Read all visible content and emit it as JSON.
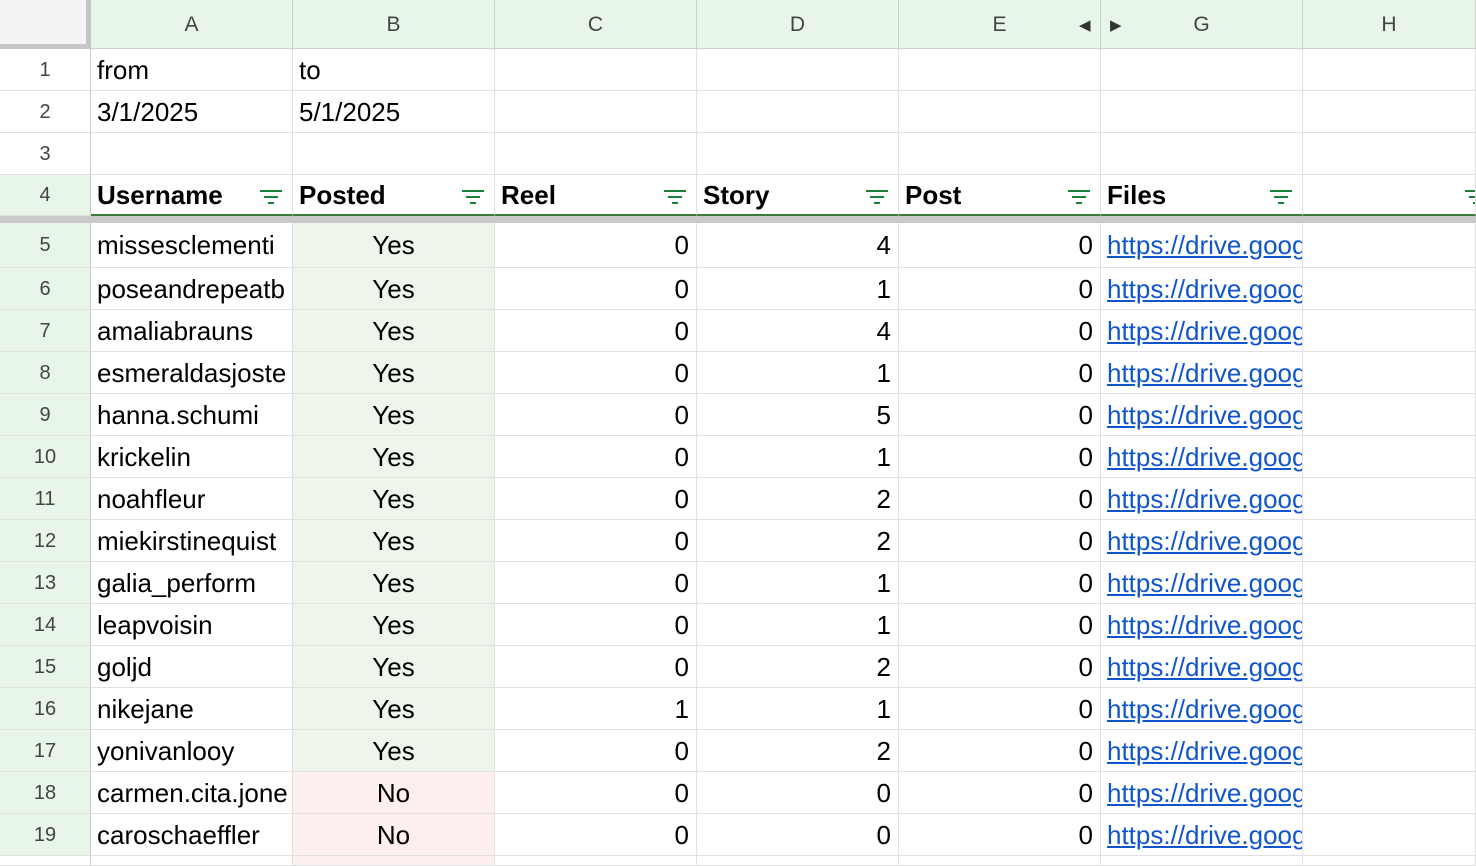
{
  "columns": [
    "A",
    "B",
    "C",
    "D",
    "E",
    "G",
    "H"
  ],
  "row1": {
    "num": "1",
    "a": "from",
    "b": "to"
  },
  "row2": {
    "num": "2",
    "a": "3/1/2025",
    "b": "5/1/2025"
  },
  "row3": {
    "num": "3"
  },
  "header_row": {
    "num": "4",
    "cells": [
      "Username",
      "Posted",
      "Reel",
      "Story",
      "Post",
      "Files",
      ""
    ]
  },
  "rows": [
    {
      "num": "5",
      "username": "missesclementi",
      "posted": "Yes",
      "reel": "0",
      "story": "4",
      "post": "0",
      "files": "https://drive.goog"
    },
    {
      "num": "6",
      "username": "poseandrepeatb",
      "posted": "Yes",
      "reel": "0",
      "story": "1",
      "post": "0",
      "files": "https://drive.goog"
    },
    {
      "num": "7",
      "username": "amaliabrauns",
      "posted": "Yes",
      "reel": "0",
      "story": "4",
      "post": "0",
      "files": "https://drive.goog"
    },
    {
      "num": "8",
      "username": "esmeraldasjoste",
      "posted": "Yes",
      "reel": "0",
      "story": "1",
      "post": "0",
      "files": "https://drive.goog"
    },
    {
      "num": "9",
      "username": "hanna.schumi",
      "posted": "Yes",
      "reel": "0",
      "story": "5",
      "post": "0",
      "files": "https://drive.goog"
    },
    {
      "num": "10",
      "username": "krickelin",
      "posted": "Yes",
      "reel": "0",
      "story": "1",
      "post": "0",
      "files": "https://drive.goog"
    },
    {
      "num": "11",
      "username": "noahfleur",
      "posted": "Yes",
      "reel": "0",
      "story": "2",
      "post": "0",
      "files": "https://drive.goog"
    },
    {
      "num": "12",
      "username": "miekirstinequist",
      "posted": "Yes",
      "reel": "0",
      "story": "2",
      "post": "0",
      "files": "https://drive.goog"
    },
    {
      "num": "13",
      "username": "galia_perform",
      "posted": "Yes",
      "reel": "0",
      "story": "1",
      "post": "0",
      "files": "https://drive.goog"
    },
    {
      "num": "14",
      "username": "leapvoisin",
      "posted": "Yes",
      "reel": "0",
      "story": "1",
      "post": "0",
      "files": "https://drive.goog"
    },
    {
      "num": "15",
      "username": "goljd",
      "posted": "Yes",
      "reel": "0",
      "story": "2",
      "post": "0",
      "files": "https://drive.goog"
    },
    {
      "num": "16",
      "username": "nikejane",
      "posted": "Yes",
      "reel": "1",
      "story": "1",
      "post": "0",
      "files": "https://drive.goog"
    },
    {
      "num": "17",
      "username": "yonivanlooy",
      "posted": "Yes",
      "reel": "0",
      "story": "2",
      "post": "0",
      "files": "https://drive.goog"
    },
    {
      "num": "18",
      "username": "carmen.cita.jone",
      "posted": "No",
      "reel": "0",
      "story": "0",
      "post": "0",
      "files": "https://drive.goog"
    },
    {
      "num": "19",
      "username": "caroschaeffler",
      "posted": "No",
      "reel": "0",
      "story": "0",
      "post": "0",
      "files": "https://drive.goog"
    }
  ],
  "colors": {
    "header_bg": "#e8f5e9",
    "yes_bg": "#eef6ec",
    "no_bg": "#fcefee",
    "link": "#1155cc",
    "filter_icon": "#188038"
  },
  "icons": {
    "filter": "filter-icon",
    "hidden_left": "hidden-columns-left-arrow-icon",
    "hidden_right": "hidden-columns-right-arrow-icon"
  }
}
